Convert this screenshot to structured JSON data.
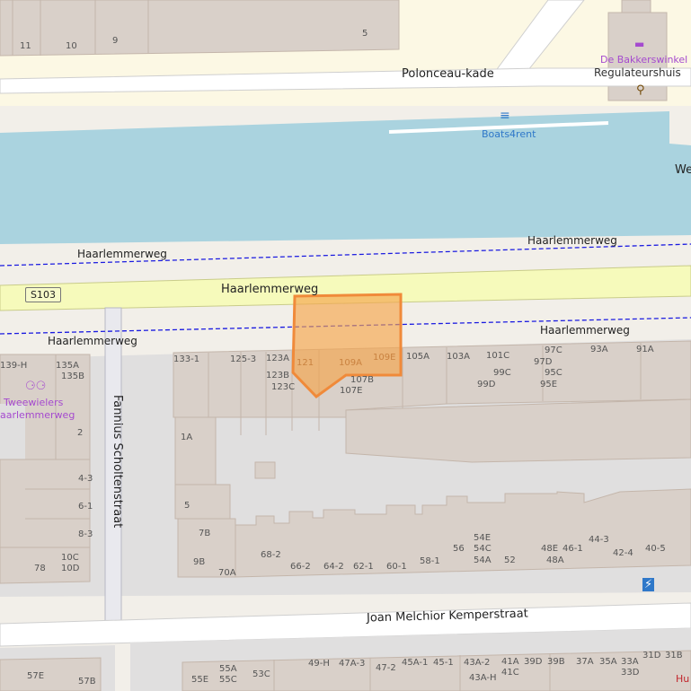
{
  "streets": {
    "polonceau": "Polonceau-kade",
    "haarlemmerweg_main": "Haarlemmerweg",
    "haarlemmerweg_path_north_1": "Haarlemmerweg",
    "haarlemmerweg_path_north_2": "Haarlemmerweg",
    "haarlemmerweg_path_south_1": "Haarlemmerweg",
    "haarlemmerweg_path_south_2": "Haarlemmerweg",
    "fannius": "Fannius Scholtenstraat",
    "joan": "Joan Melchior Kemperstraat",
    "road_ref": "S103"
  },
  "pois": {
    "bakkerswinkel": "De Bakkerswinkel",
    "regulateurshuis": "Regulateurshuis",
    "boats4rent": "Boats4rent",
    "tweewielers_1": "Tweewielers",
    "tweewielers_2": "aarlemmerweg",
    "we_cut": "We",
    "hu_cut": "Hu"
  },
  "house_numbers": {
    "n11": "11",
    "n10": "10",
    "n9": "9",
    "n5_top": "5",
    "n133_1": "133-1",
    "n125_3": "125-3",
    "n123A": "123A",
    "n123B": "123B",
    "n123C": "123C",
    "n121": "121",
    "n109A": "109A",
    "n109E": "109E",
    "n107B": "107B",
    "n107E": "107E",
    "n105A": "105A",
    "n103A": "103A",
    "n101C": "101C",
    "n99C": "99C",
    "n99D": "99D",
    "n97C": "97C",
    "n97D": "97D",
    "n95C": "95C",
    "n95E": "95E",
    "n93A": "93A",
    "n91A": "91A",
    "n139H": "139-H",
    "n135A": "135A",
    "n135B": "135B",
    "n2": "2",
    "n4_3": "4-3",
    "n6_1": "6-1",
    "n8_3": "8-3",
    "n10C": "10C",
    "n10D": "10D",
    "n78": "78",
    "n1A": "1A",
    "n5": "5",
    "n7B": "7B",
    "n9B": "9B",
    "n70A": "70A",
    "n68_2": "68-2",
    "n66_2": "66-2",
    "n64_2": "64-2",
    "n62_1": "62-1",
    "n60_1": "60-1",
    "n58_1": "58-1",
    "n56": "56",
    "n54E": "54E",
    "n54C": "54C",
    "n54A": "54A",
    "n52": "52",
    "n48E": "48E",
    "n46_1": "46-1",
    "n48A": "48A",
    "n44_3": "44-3",
    "n42_4": "42-4",
    "n40_5": "40-5",
    "n57E": "57E",
    "n57B": "57B",
    "n55A": "55A",
    "n55E": "55E",
    "n55C": "55C",
    "n53C": "53C",
    "n49H": "49-H",
    "n47A3": "47A-3",
    "n47_2": "47-2",
    "n45A1": "45A-1",
    "n45_1": "45-1",
    "n43A2": "43A-2",
    "n41A": "41A",
    "n39D": "39D",
    "n39B": "39B",
    "n37A": "37A",
    "n35A": "35A",
    "n33A": "33A",
    "n31D": "31D",
    "n31B": "31B",
    "n43AH": "43A-H",
    "n41C": "41C",
    "n33D": "33D"
  },
  "colors": {
    "land": "#f2efe9",
    "water": "#aad3df",
    "building": "#d9d0c9",
    "building_stroke": "#c4b6ab",
    "residential": "#e0dfdf",
    "road": "#ffffff",
    "primary": "#f6fabb",
    "highlight": "#f5a54b",
    "cycle": "#1a1ae0",
    "poi": "#a54acf",
    "blue_poi": "#2f78c9"
  }
}
